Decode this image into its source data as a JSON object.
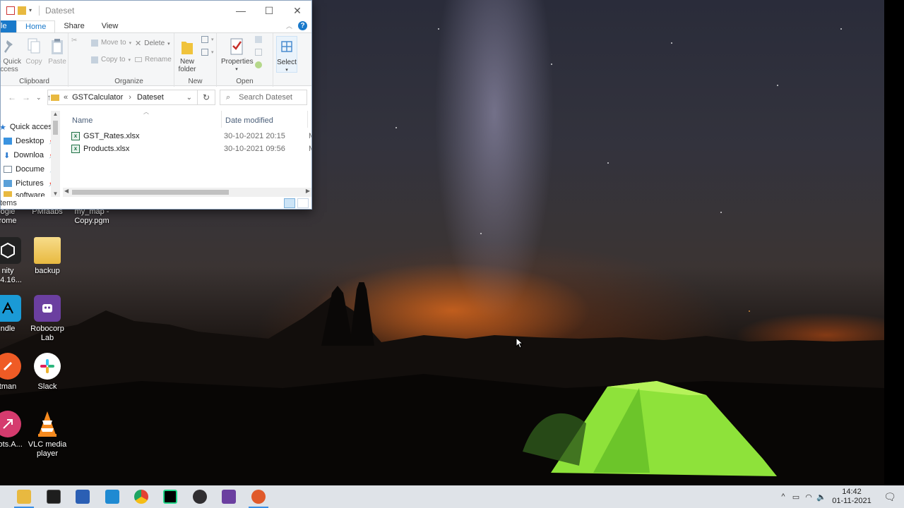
{
  "explorer": {
    "title": "Dateset",
    "controls": {
      "minimize": "—",
      "maximize": "☐",
      "close": "✕"
    },
    "ribbon_tabs": [
      {
        "label": "le"
      },
      {
        "label": "Home"
      },
      {
        "label": "Share"
      },
      {
        "label": "View"
      }
    ],
    "help": "?",
    "ribbon": {
      "clipboard": {
        "group_label": "Clipboard",
        "pin": "o Quick\nccess",
        "copy": "Copy",
        "paste": "Paste"
      },
      "organize": {
        "group_label": "Organize",
        "move_to": "Move to",
        "copy_to": "Copy to",
        "delete": "Delete",
        "rename": "Rename"
      },
      "new": {
        "group_label": "New",
        "new_folder": "New\nfolder"
      },
      "open": {
        "group_label": "Open",
        "properties": "Properties"
      },
      "select": {
        "select": "Select"
      }
    },
    "address": {
      "prefix": "«",
      "crumbs": [
        "GSTCalculator",
        "Dateset"
      ],
      "search_placeholder": "Search Dateset"
    },
    "navpane": [
      {
        "label": "Quick access",
        "icon": "star-icon",
        "pinned": false
      },
      {
        "label": "Desktop",
        "icon": "desktop-folder-icon",
        "pinned": true
      },
      {
        "label": "Downloa",
        "icon": "downloads-icon",
        "pinned": true
      },
      {
        "label": "Docume",
        "icon": "documents-icon",
        "pinned": true
      },
      {
        "label": "Pictures",
        "icon": "pictures-icon",
        "pinned": true
      },
      {
        "label": "software",
        "icon": "folder-icon",
        "pinned": false
      }
    ],
    "columns": {
      "name": "Name",
      "date_modified": "Date modified"
    },
    "files": [
      {
        "name": "GST_Rates.xlsx",
        "date": "30-10-2021 20:15",
        "type_fragment": "M"
      },
      {
        "name": "Products.xlsx",
        "date": "30-10-2021 09:56",
        "type_fragment": "M"
      }
    ],
    "status": "tems"
  },
  "desktop_icons": [
    {
      "label": "ogle\nrome",
      "icon": "chrome-icon"
    },
    {
      "label": "PMfaabs",
      "icon": "file-icon"
    },
    {
      "label": "my_map -\nCopy.pgm",
      "icon": "file-icon"
    },
    {
      "label": "nity\n0.4.16...",
      "icon": "unity-icon"
    },
    {
      "label": "backup",
      "icon": "folder-icon"
    },
    {
      "label": "ndle",
      "icon": "kindle-icon"
    },
    {
      "label": "Robocorp\nLab",
      "icon": "robocorp-icon"
    },
    {
      "label": "tman",
      "icon": "postman-icon"
    },
    {
      "label": "Slack",
      "icon": "slack-icon"
    },
    {
      "label": "Bots.A...",
      "icon": "bots-icon"
    },
    {
      "label": "VLC media\nplayer",
      "icon": "vlc-icon"
    }
  ],
  "taskbar": {
    "apps": [
      {
        "name": "file-explorer",
        "color": "#e8b940",
        "active": true
      },
      {
        "name": "terminal",
        "color": "#1e1e1e",
        "active": false
      },
      {
        "name": "powershell",
        "color": "#2b5fb4",
        "active": false
      },
      {
        "name": "vscode",
        "color": "#1f8ad2",
        "active": false
      },
      {
        "name": "chrome",
        "color": "#e34133",
        "active": false
      },
      {
        "name": "pycharm",
        "color": "#21d789",
        "active": false
      },
      {
        "name": "obs",
        "color": "#302e31",
        "active": false
      },
      {
        "name": "robocorp",
        "color": "#6b3fa0",
        "active": false
      },
      {
        "name": "app-orange",
        "color": "#e05a2b",
        "active": true
      }
    ],
    "time": "14:42",
    "date": "01-11-2021"
  }
}
